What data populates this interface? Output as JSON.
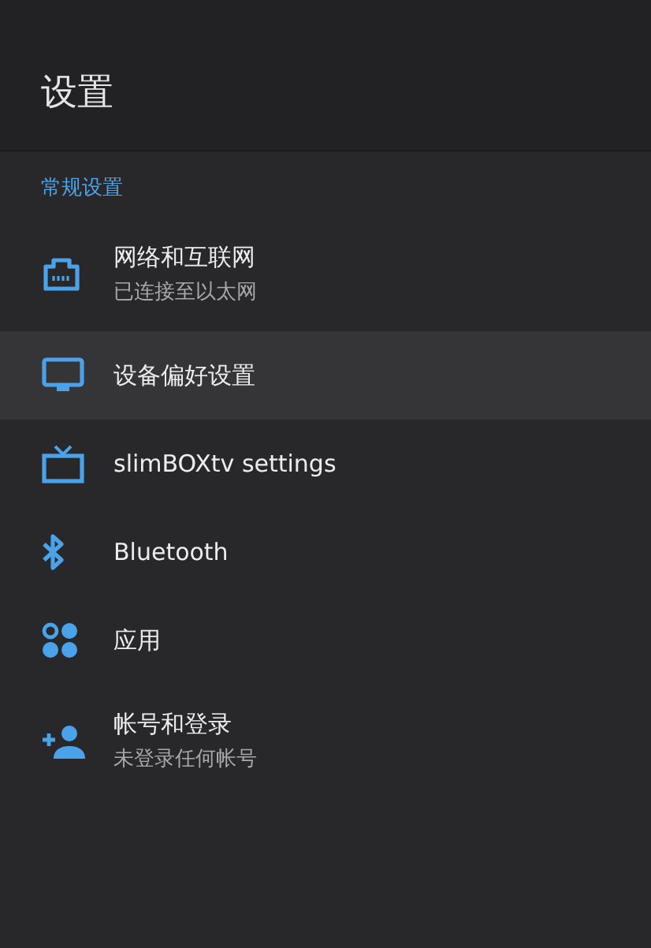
{
  "header": {
    "title": "设置"
  },
  "section": {
    "label": "常规设置"
  },
  "items": [
    {
      "kind": "ethernet",
      "title": "网络和互联网",
      "subtitle": "已连接至以太网",
      "selected": false
    },
    {
      "kind": "monitor",
      "title": "设备偏好设置",
      "selected": true
    },
    {
      "kind": "tv",
      "title": "slimBOXtv settings",
      "selected": false
    },
    {
      "kind": "bluetooth",
      "title": "Bluetooth",
      "selected": false
    },
    {
      "kind": "apps",
      "title": "应用",
      "selected": false
    },
    {
      "kind": "add-person",
      "title": "帐号和登录",
      "subtitle": "未登录任何帐号",
      "selected": false
    }
  ]
}
